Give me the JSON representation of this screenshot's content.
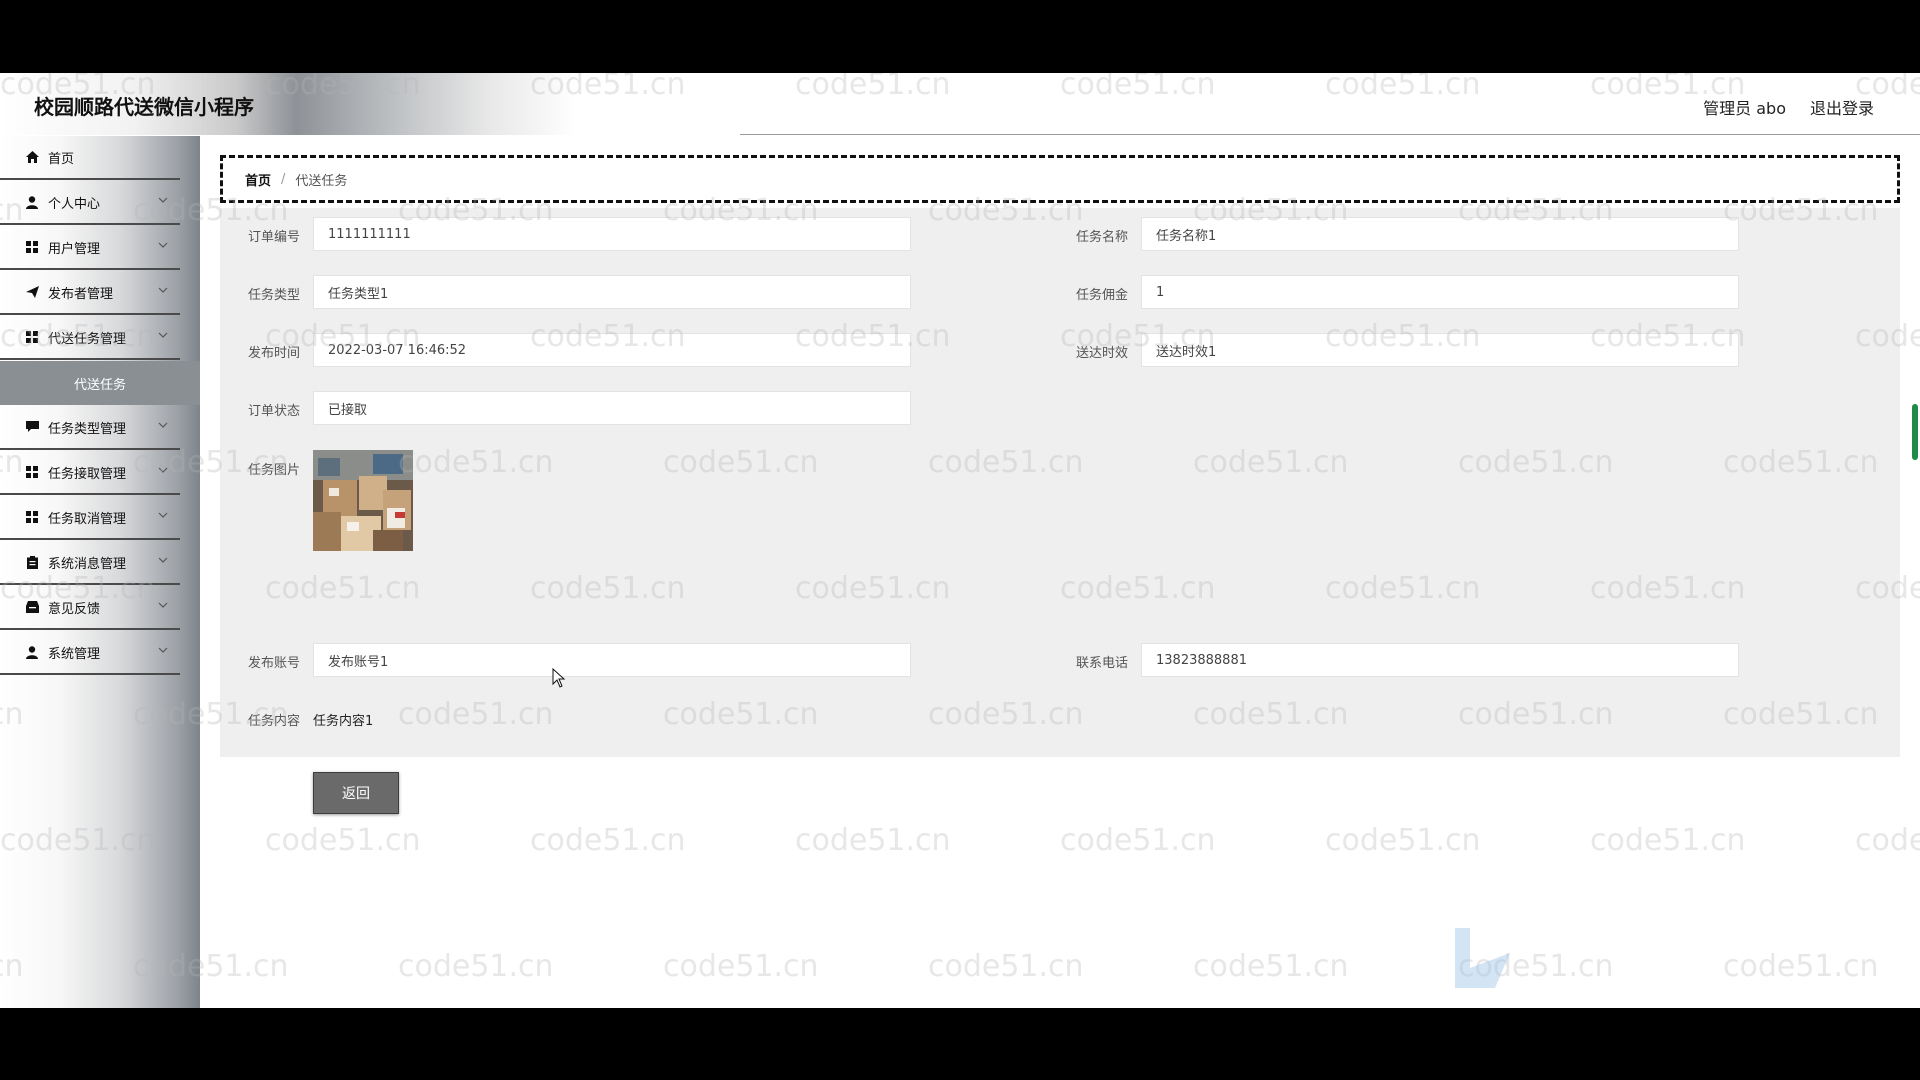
{
  "header": {
    "app_title": "校园顺路代送微信小程序",
    "admin_label": "管理员 abo",
    "logout_label": "退出登录"
  },
  "sidebar": {
    "items": [
      {
        "label": "首页",
        "icon": "home-icon"
      },
      {
        "label": "个人中心",
        "icon": "user-icon"
      },
      {
        "label": "用户管理",
        "icon": "grid-icon"
      },
      {
        "label": "发布者管理",
        "icon": "send-icon"
      },
      {
        "label": "代送任务管理",
        "icon": "grid-icon"
      },
      {
        "label": "代送任务",
        "icon": ""
      },
      {
        "label": "任务类型管理",
        "icon": "comment-icon"
      },
      {
        "label": "任务接取管理",
        "icon": "grid-icon"
      },
      {
        "label": "任务取消管理",
        "icon": "grid-icon"
      },
      {
        "label": "系统消息管理",
        "icon": "clipboard-icon"
      },
      {
        "label": "意见反馈",
        "icon": "inbox-icon"
      },
      {
        "label": "系统管理",
        "icon": "user-icon"
      }
    ]
  },
  "breadcrumb": {
    "home": "首页",
    "separator": "/",
    "current": "代送任务"
  },
  "form": {
    "order_no": {
      "label": "订单编号",
      "value": "1111111111"
    },
    "task_name": {
      "label": "任务名称",
      "value": "任务名称1"
    },
    "task_type": {
      "label": "任务类型",
      "value": "任务类型1"
    },
    "task_fee": {
      "label": "任务佣金",
      "value": "1"
    },
    "publish_time": {
      "label": "发布时间",
      "value": "2022-03-07 16:46:52"
    },
    "delivery_time": {
      "label": "送达时效",
      "value": "送达时效1"
    },
    "order_status": {
      "label": "订单状态",
      "value": "已接取"
    },
    "task_image": {
      "label": "任务图片"
    },
    "publish_account": {
      "label": "发布账号",
      "value": "发布账号1"
    },
    "contact_phone": {
      "label": "联系电话",
      "value": "13823888881"
    },
    "task_content": {
      "label": "任务内容",
      "value": "任务内容1"
    },
    "back_label": "返回"
  },
  "watermark_text": "code51.cn"
}
